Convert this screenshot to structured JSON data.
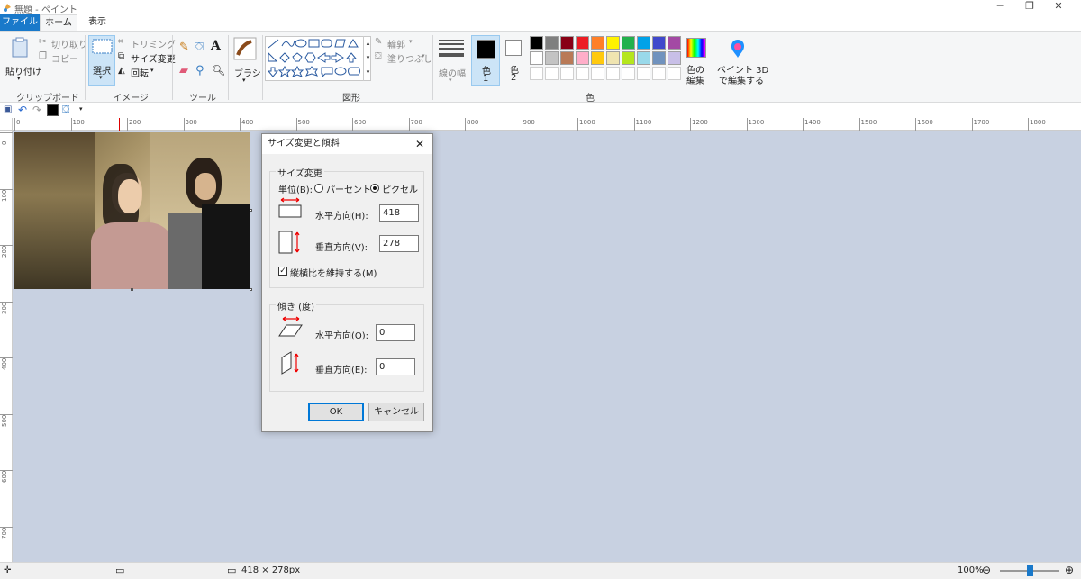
{
  "window": {
    "title": "無題 - ペイント"
  },
  "tabs": [
    {
      "label": "ファイル"
    },
    {
      "label": "ホーム"
    },
    {
      "label": "表示"
    }
  ],
  "clipboard": {
    "paste": "貼り付け",
    "cut": "切り取り",
    "copy": "コピー",
    "group": "クリップボード"
  },
  "image": {
    "select": "選択",
    "crop": "トリミング",
    "resize": "サイズ変更",
    "rotate": "回転",
    "group": "イメージ"
  },
  "tools": {
    "group": "ツール"
  },
  "brushes": {
    "label": "ブラシ"
  },
  "shapes": {
    "outline": "輪郭",
    "fill": "塗りつぶし",
    "group": "図形"
  },
  "size": {
    "label": "線の幅"
  },
  "colors": {
    "color1": "色\n1",
    "color1_a": "色",
    "color1_b": "1",
    "color2_a": "色",
    "color2_b": "2",
    "edit_a": "色の",
    "edit_b": "編集",
    "group": "色",
    "palette_row1": [
      "#000000",
      "#7f7f7f",
      "#880015",
      "#ed1c24",
      "#ff7f27",
      "#fff200",
      "#22b14c",
      "#00a2e8",
      "#3f48cc",
      "#a349a4"
    ],
    "palette_row2": [
      "#ffffff",
      "#c3c3c3",
      "#b97a57",
      "#ffaec9",
      "#ffc90e",
      "#efe4b0",
      "#b5e61d",
      "#99d9ea",
      "#7092be",
      "#c8bfe7"
    ]
  },
  "paint3d": {
    "line1": "ペイント 3D",
    "line2": "で編集する"
  },
  "ruler": {
    "h_ticks": [
      "0",
      "100",
      "200",
      "300",
      "400",
      "500",
      "600",
      "700",
      "800",
      "900",
      "1000",
      "1100",
      "1200",
      "1300",
      "1400",
      "1500",
      "1600",
      "1700",
      "1800"
    ],
    "v_ticks": [
      "0",
      "100",
      "200",
      "300",
      "400",
      "500",
      "600",
      "700"
    ]
  },
  "dialog": {
    "title": "サイズ変更と傾斜",
    "resize_group": "サイズ変更",
    "unit_label": "単位(B):",
    "percent": "パーセント",
    "pixel": "ピクセル",
    "horizontal_label": "水平方向(H):",
    "horizontal_value": "418",
    "vertical_label": "垂直方向(V):",
    "vertical_value": "278",
    "keep_ratio": "縦横比を維持する(M)",
    "skew_group": "傾き (度)",
    "skew_h_label": "水平方向(O):",
    "skew_h_value": "0",
    "skew_v_label": "垂直方向(E):",
    "skew_v_value": "0",
    "ok": "OK",
    "cancel": "キャンセル"
  },
  "status": {
    "dimensions": "418 × 278px",
    "zoom": "100%"
  }
}
